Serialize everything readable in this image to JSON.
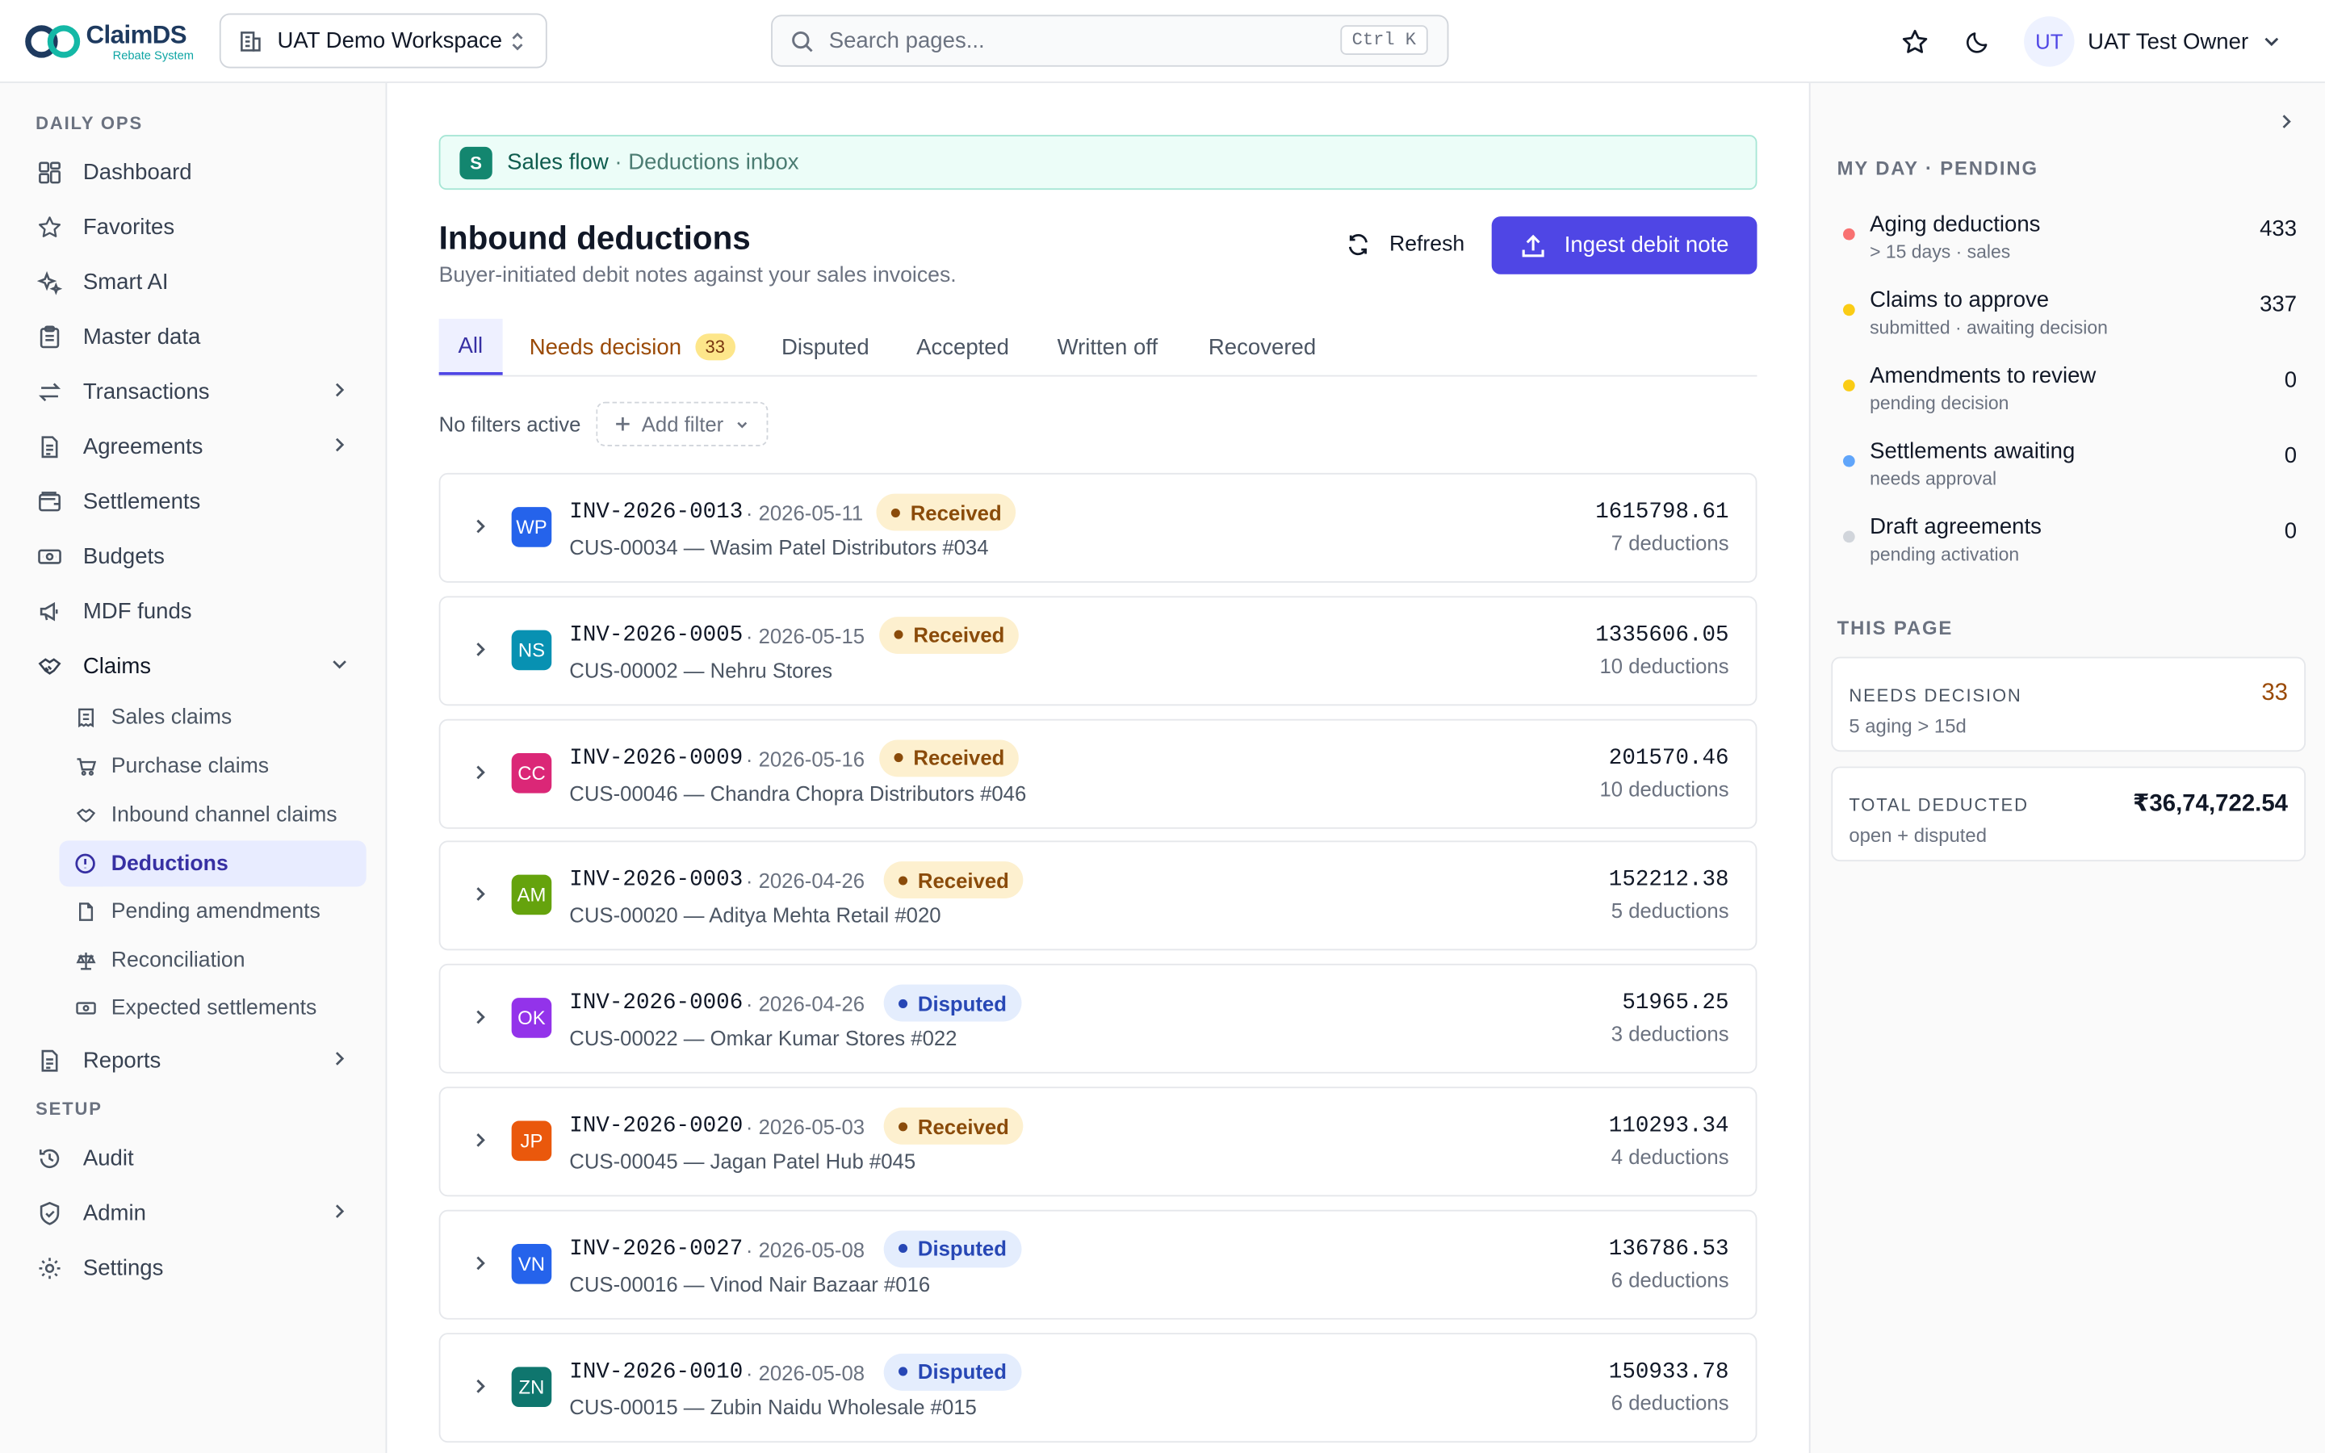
{
  "header": {
    "logo_name": "ClaimDS",
    "logo_tag": "Rebate System",
    "workspace": "UAT Demo Workspace",
    "search_placeholder": "Search pages...",
    "search_shortcut": "Ctrl K",
    "user_initials": "UT",
    "user_name": "UAT Test Owner"
  },
  "sidebar": {
    "section_daily": "DAILY OPS",
    "section_setup": "SETUP",
    "items": {
      "dashboard": "Dashboard",
      "favorites": "Favorites",
      "smart_ai": "Smart AI",
      "master_data": "Master data",
      "transactions": "Transactions",
      "agreements": "Agreements",
      "settlements": "Settlements",
      "budgets": "Budgets",
      "mdf_funds": "MDF funds",
      "claims": "Claims",
      "reports": "Reports",
      "audit": "Audit",
      "admin": "Admin",
      "settings": "Settings"
    },
    "claims_sub": {
      "sales_claims": "Sales claims",
      "purchase_claims": "Purchase claims",
      "inbound_channel_claims": "Inbound channel claims",
      "deductions": "Deductions",
      "pending_amendments": "Pending amendments",
      "reconciliation": "Reconciliation",
      "expected_settlements": "Expected settlements"
    }
  },
  "main": {
    "banner_badge": "S",
    "banner_flow": "Sales flow",
    "banner_crumb": "· Deductions inbox",
    "title": "Inbound deductions",
    "subtitle": "Buyer-initiated debit notes against your sales invoices.",
    "refresh_label": "Refresh",
    "ingest_label": "Ingest debit note",
    "tabs": {
      "all": "All",
      "needs_decision": "Needs decision",
      "needs_decision_count": "33",
      "disputed": "Disputed",
      "accepted": "Accepted",
      "written_off": "Written off",
      "recovered": "Recovered"
    },
    "no_filters": "No filters active",
    "add_filter": "Add filter",
    "rows": [
      {
        "initials": "WP",
        "color": "#2563eb",
        "invoice": "INV-2026-0013",
        "date": "· 2026-05-11",
        "status": "Received",
        "customer": "CUS-00034 — Wasim Patel Distributors #034",
        "amount": "1615798.61",
        "deductions": "7 deductions"
      },
      {
        "initials": "NS",
        "color": "#0891b2",
        "invoice": "INV-2026-0005",
        "date": "· 2026-05-15",
        "status": "Received",
        "customer": "CUS-00002 — Nehru Stores",
        "amount": "1335606.05",
        "deductions": "10 deductions"
      },
      {
        "initials": "CC",
        "color": "#db2777",
        "invoice": "INV-2026-0009",
        "date": "· 2026-05-16",
        "status": "Received",
        "customer": "CUS-00046 — Chandra Chopra Distributors #046",
        "amount": "201570.46",
        "deductions": "10 deductions"
      },
      {
        "initials": "AM",
        "color": "#65a30d",
        "invoice": "INV-2026-0003",
        "date": "· 2026-04-26",
        "status": "Received",
        "customer": "CUS-00020 — Aditya Mehta Retail #020",
        "amount": "152212.38",
        "deductions": "5 deductions"
      },
      {
        "initials": "OK",
        "color": "#9333ea",
        "invoice": "INV-2026-0006",
        "date": "· 2026-04-26",
        "status": "Disputed",
        "customer": "CUS-00022 — Omkar Kumar Stores #022",
        "amount": "51965.25",
        "deductions": "3 deductions"
      },
      {
        "initials": "JP",
        "color": "#ea580c",
        "invoice": "INV-2026-0020",
        "date": "· 2026-05-03",
        "status": "Received",
        "customer": "CUS-00045 — Jagan Patel Hub #045",
        "amount": "110293.34",
        "deductions": "4 deductions"
      },
      {
        "initials": "VN",
        "color": "#2563eb",
        "invoice": "INV-2026-0027",
        "date": "· 2026-05-08",
        "status": "Disputed",
        "customer": "CUS-00016 — Vinod Nair Bazaar #016",
        "amount": "136786.53",
        "deductions": "6 deductions"
      },
      {
        "initials": "ZN",
        "color": "#0f766e",
        "invoice": "INV-2026-0010",
        "date": "· 2026-05-08",
        "status": "Disputed",
        "customer": "CUS-00015 — Zubin Naidu Wholesale #015",
        "amount": "150933.78",
        "deductions": "6 deductions"
      }
    ]
  },
  "right_panel": {
    "my_day_title": "MY DAY · PENDING",
    "pending": [
      {
        "title": "Aging deductions",
        "sub": "> 15 days · sales",
        "count": "433",
        "color": "#f87171"
      },
      {
        "title": "Claims to approve",
        "sub": "submitted · awaiting decision",
        "count": "337",
        "color": "#facc15"
      },
      {
        "title": "Amendments to review",
        "sub": "pending decision",
        "count": "0",
        "color": "#facc15"
      },
      {
        "title": "Settlements awaiting",
        "sub": "needs approval",
        "count": "0",
        "color": "#60a5fa"
      },
      {
        "title": "Draft agreements",
        "sub": "pending activation",
        "count": "0",
        "color": "#d1d5db"
      }
    ],
    "this_page_title": "THIS PAGE",
    "needs_decision_label": "NEEDS DECISION",
    "needs_decision_sub": "5 aging > 15d",
    "needs_decision_value": "33",
    "total_deducted_label": "TOTAL DEDUCTED",
    "total_deducted_sub": "open + disputed",
    "total_deducted_value": "₹36,74,722.54"
  }
}
